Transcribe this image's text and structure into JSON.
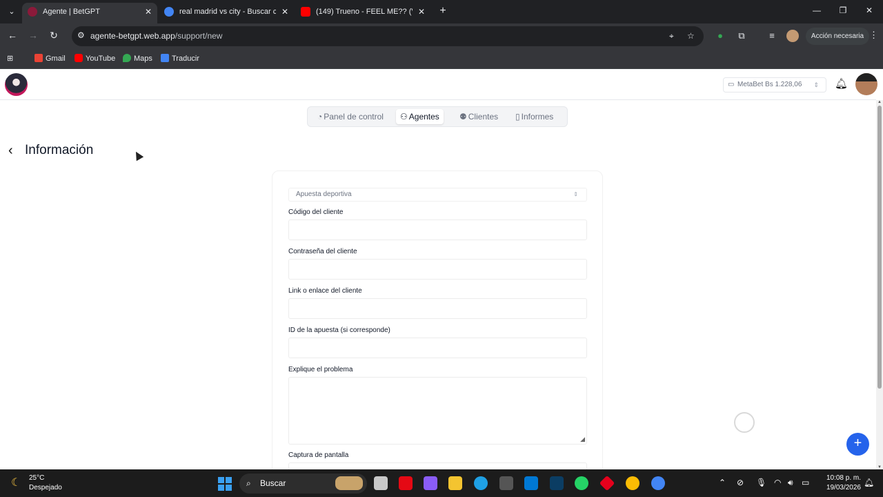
{
  "browser": {
    "tabs": [
      {
        "title": "Agente | BetGPT",
        "active": true,
        "favicon_color": "#8b1a3a"
      },
      {
        "title": "real madrid vs city - Buscar con",
        "active": false,
        "favicon_color": "#4285f4"
      },
      {
        "title": "(149) Trueno - FEEL ME?? (Vide",
        "active": false,
        "favicon_color": "#ff0000"
      }
    ],
    "url_host": "agente-betgpt.web.app",
    "url_path": "/support/new",
    "action_button": "Acción necesaria",
    "bookmarks": [
      "Gmail",
      "YouTube",
      "Maps",
      "Traducir"
    ]
  },
  "header": {
    "balance": "MetaBet Bs 1.228,06"
  },
  "nav": {
    "tabs": [
      {
        "label": "Panel de control",
        "icon": "gauge-icon",
        "active": false
      },
      {
        "label": "Agentes",
        "icon": "user-icon",
        "active": true
      },
      {
        "label": "Clientes",
        "icon": "users-icon",
        "active": false
      },
      {
        "label": "Informes",
        "icon": "clipboard-icon",
        "active": false
      }
    ]
  },
  "page": {
    "title": "Información"
  },
  "form": {
    "type_select": "Apuesta deportiva",
    "client_code_label": "Código del cliente",
    "client_password_label": "Contraseña del cliente",
    "client_link_label": "Link o enlace del cliente",
    "bet_id_label": "ID de la apuesta (si corresponde)",
    "problem_label": "Explique el problema",
    "screenshot_label": "Captura de pantalla"
  },
  "taskbar": {
    "temperature": "25°C",
    "weather": "Despejado",
    "search": "Buscar",
    "time": "10:08 p. m.",
    "date": "19/03/2026"
  },
  "colors": {
    "accent": "#2563eb",
    "chrome_dark": "#202124",
    "chrome_mid": "#35363a"
  }
}
